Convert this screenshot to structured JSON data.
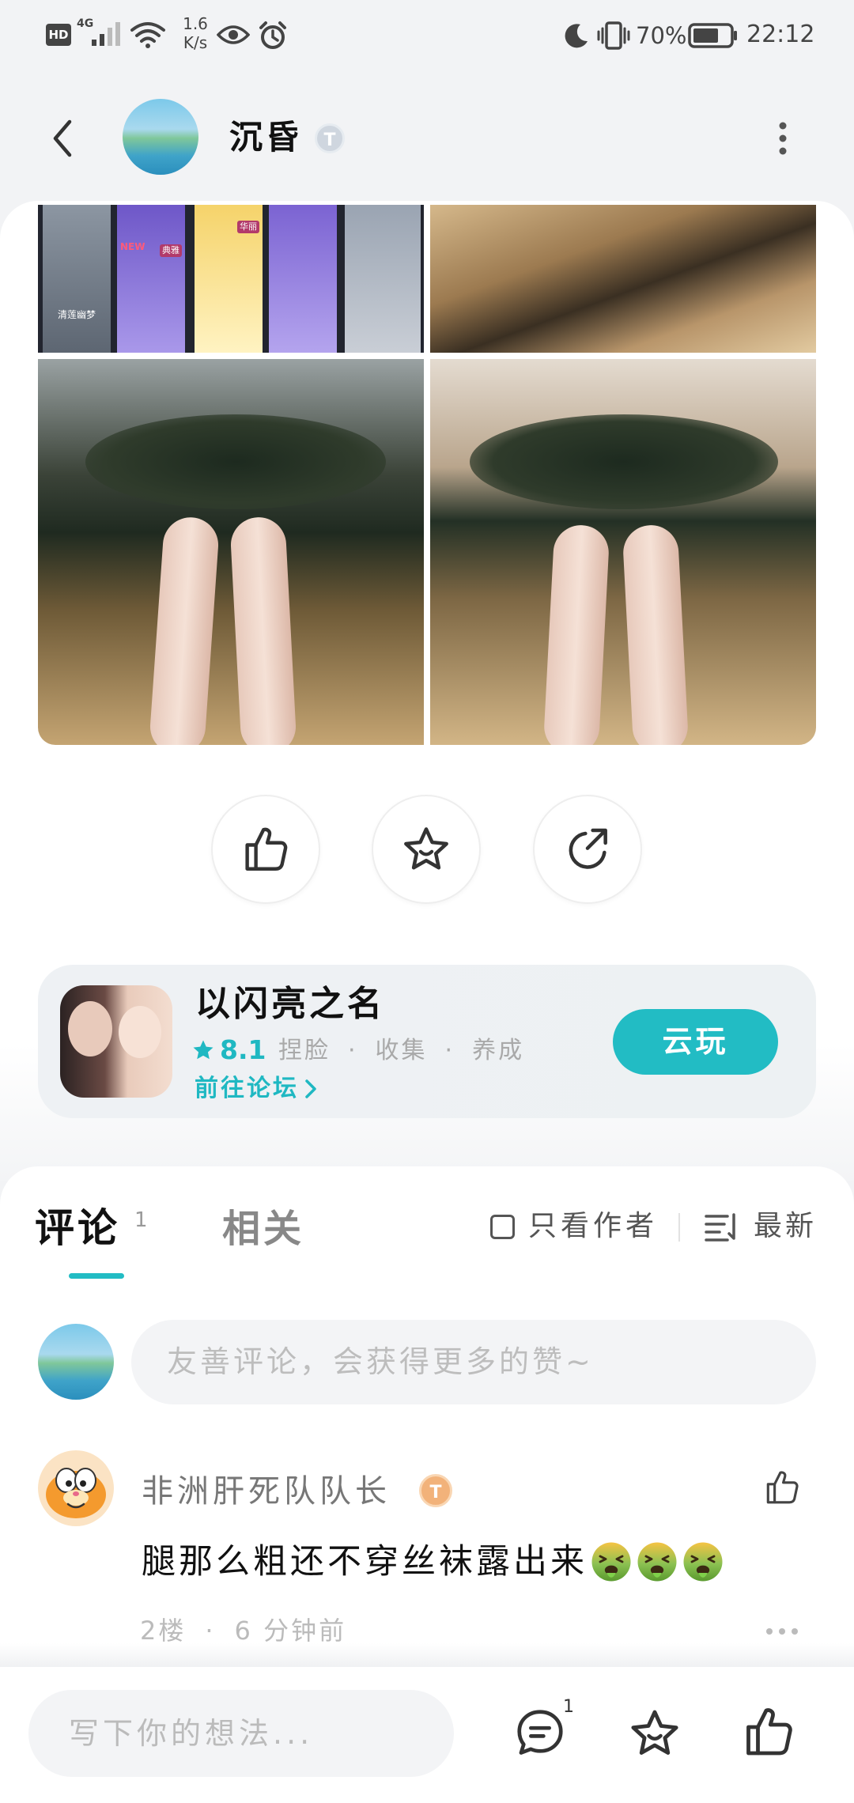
{
  "status_bar": {
    "hd": "HD",
    "network": "4G",
    "speed_value": "1.6",
    "speed_unit": "K/s",
    "battery_percent": "70%",
    "time": "22:12"
  },
  "header": {
    "title": "沉昏",
    "badge": "T"
  },
  "post": {
    "image_labels": {
      "card_title": "清莲幽梦",
      "new_tag": "NEW",
      "tag_elegant": "典雅",
      "tag_gorgeous": "华丽"
    },
    "actions": [
      "like-icon",
      "favorite-star-icon",
      "share-icon"
    ]
  },
  "game": {
    "name": "以闪亮之名",
    "rating": "8.1",
    "tags": [
      "捏脸",
      "收集",
      "养成"
    ],
    "separator": "·",
    "forum_link": "前往论坛",
    "play_button": "云玩"
  },
  "comments_section": {
    "tabs": [
      {
        "label": "评论",
        "count": "1",
        "active": true
      },
      {
        "label": "相关",
        "active": false
      }
    ],
    "author_only": "只看作者",
    "author_only_checked": false,
    "sort": "最新",
    "input_placeholder": "友善评论，会获得更多的赞~"
  },
  "comments": [
    {
      "username": "非洲肝死队队长",
      "badge": "T",
      "text": "腿那么粗还不穿丝袜露出来",
      "emoji_icon": "vomiting-face-emoji",
      "emoji_count": 3,
      "floor": "2楼",
      "separator": "·",
      "time": "6 分钟前"
    }
  ],
  "bottom_bar": {
    "placeholder": "写下你的想法...",
    "comment_count": "1"
  },
  "colors": {
    "accent": "#22bcc4",
    "page_background": "#f2f3f5",
    "card_background": "#ffffff"
  }
}
